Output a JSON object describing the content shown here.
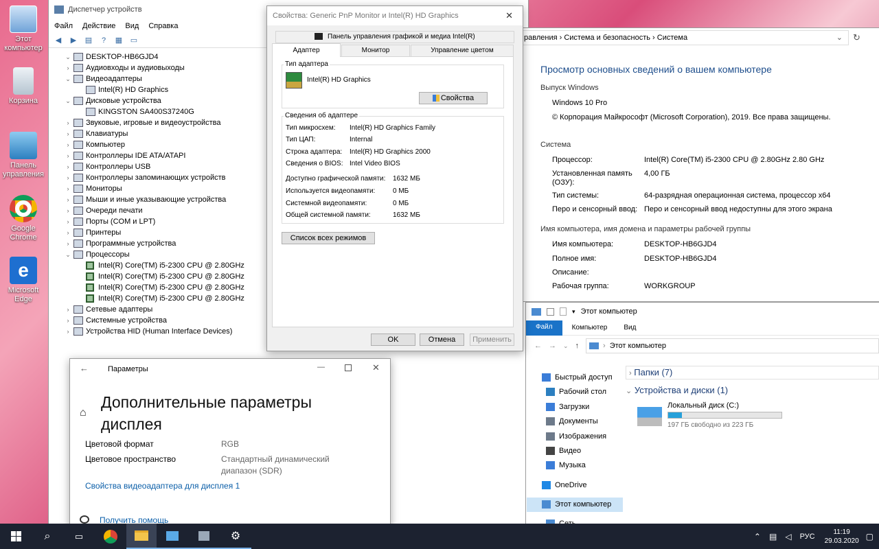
{
  "desktop": {
    "icons": [
      {
        "label": "Этот компьютер",
        "icon": "computer-icon"
      },
      {
        "label": "Корзина",
        "icon": "recycle-bin-icon"
      },
      {
        "label": "Панель управления",
        "icon": "control-panel-icon"
      },
      {
        "label": "Google Chrome",
        "icon": "chrome-icon"
      },
      {
        "label": "Microsoft Edge",
        "icon": "edge-icon"
      }
    ]
  },
  "devmgr": {
    "title": "Диспетчер устройств",
    "menu": [
      "Файл",
      "Действие",
      "Вид",
      "Справка"
    ],
    "tree": [
      {
        "label": "DESKTOP-HB6GJD4",
        "level": 0,
        "expanded": true
      },
      {
        "label": "Аудиовходы и аудиовыходы",
        "level": 1
      },
      {
        "label": "Видеоадаптеры",
        "level": 1,
        "expanded": true
      },
      {
        "label": "Intel(R) HD Graphics",
        "level": 2
      },
      {
        "label": "Дисковые устройства",
        "level": 1,
        "expanded": true
      },
      {
        "label": "KINGSTON SA400S37240G",
        "level": 2
      },
      {
        "label": "Звуковые, игровые и видеоустройства",
        "level": 1
      },
      {
        "label": "Клавиатуры",
        "level": 1
      },
      {
        "label": "Компьютер",
        "level": 1
      },
      {
        "label": "Контроллеры IDE ATA/ATAPI",
        "level": 1
      },
      {
        "label": "Контроллеры USB",
        "level": 1
      },
      {
        "label": "Контроллеры запоминающих устройств",
        "level": 1
      },
      {
        "label": "Мониторы",
        "level": 1
      },
      {
        "label": "Мыши и иные указывающие устройства",
        "level": 1
      },
      {
        "label": "Очереди печати",
        "level": 1
      },
      {
        "label": "Порты (COM и LPT)",
        "level": 1
      },
      {
        "label": "Принтеры",
        "level": 1
      },
      {
        "label": "Программные устройства",
        "level": 1
      },
      {
        "label": "Процессоры",
        "level": 1,
        "expanded": true
      },
      {
        "label": "Intel(R) Core(TM) i5-2300 CPU @ 2.80GHz",
        "level": 2,
        "cpu": true
      },
      {
        "label": "Intel(R) Core(TM) i5-2300 CPU @ 2.80GHz",
        "level": 2,
        "cpu": true
      },
      {
        "label": "Intel(R) Core(TM) i5-2300 CPU @ 2.80GHz",
        "level": 2,
        "cpu": true
      },
      {
        "label": "Intel(R) Core(TM) i5-2300 CPU @ 2.80GHz",
        "level": 2,
        "cpu": true
      },
      {
        "label": "Сетевые адаптеры",
        "level": 1
      },
      {
        "label": "Системные устройства",
        "level": 1
      },
      {
        "label": "Устройства HID (Human Interface Devices)",
        "level": 1
      }
    ]
  },
  "props": {
    "title": "Свойства: Generic PnP Monitor и Intel(R) HD Graphics",
    "top_tab": "Панель управления графикой и медиа Intel(R)",
    "tabs": [
      "Адаптер",
      "Монитор",
      "Управление цветом"
    ],
    "adapter_type_label": "Тип адаптера",
    "adapter_name": "Intel(R) HD Graphics",
    "properties_btn": "Свойства",
    "info_label": "Сведения об адаптере",
    "info": [
      {
        "k": "Тип микросхем:",
        "v": "Intel(R) HD Graphics Family"
      },
      {
        "k": "Тип ЦАП:",
        "v": "Internal"
      },
      {
        "k": "Строка адаптера:",
        "v": "Intel(R) HD Graphics 2000"
      },
      {
        "k": "Сведения о BIOS:",
        "v": "Intel Video BIOS"
      }
    ],
    "memory": [
      {
        "k": "Доступно графической памяти:",
        "v": "1632 МБ"
      },
      {
        "k": "Используется видеопамяти:",
        "v": "0 МБ"
      },
      {
        "k": "Системной видеопамяти:",
        "v": "0 МБ"
      },
      {
        "k": "Общей системной памяти:",
        "v": "1632 МБ"
      }
    ],
    "modes_btn": "Список всех режимов",
    "ok": "OK",
    "cancel": "Отмена",
    "apply": "Применить"
  },
  "system": {
    "breadcrumb": "равления  ›  Система и безопасность  ›  Система",
    "heading": "Просмотр основных сведений о вашем компьютере",
    "edition_section": "Выпуск Windows",
    "edition": "Windows 10 Pro",
    "copyright": "© Корпорация Майкрософт (Microsoft Corporation), 2019. Все права защищены.",
    "system_section": "Система",
    "rows": [
      {
        "k": "Процессор:",
        "v": "Intel(R) Core(TM) i5-2300 CPU @ 2.80GHz   2.80 GHz"
      },
      {
        "k": "Установленная память (ОЗУ):",
        "v": "4,00 ГБ"
      },
      {
        "k": "Тип системы:",
        "v": "64-разрядная операционная система, процессор x64"
      },
      {
        "k": "Перо и сенсорный ввод:",
        "v": "Перо и сенсорный ввод недоступны для этого экрана"
      }
    ],
    "name_section": "Имя компьютера, имя домена и параметры рабочей группы",
    "name_rows": [
      {
        "k": "Имя компьютера:",
        "v": "DESKTOP-HB6GJD4"
      },
      {
        "k": "Полное имя:",
        "v": "DESKTOP-HB6GJD4"
      },
      {
        "k": "Описание:",
        "v": ""
      },
      {
        "k": "Рабочая группа:",
        "v": "WORKGROUP"
      }
    ]
  },
  "explorer": {
    "title": "Этот компьютер",
    "ribbon": [
      "Файл",
      "Компьютер",
      "Вид"
    ],
    "address": "Этот компьютер",
    "nav": [
      {
        "label": "Быстрый доступ",
        "icon": "star-icon"
      },
      {
        "label": "Рабочий стол",
        "icon": "desktop-folder-icon"
      },
      {
        "label": "Загрузки",
        "icon": "downloads-icon"
      },
      {
        "label": "Документы",
        "icon": "documents-icon"
      },
      {
        "label": "Изображения",
        "icon": "pictures-icon"
      },
      {
        "label": "Видео",
        "icon": "video-icon"
      },
      {
        "label": "Музыка",
        "icon": "music-icon"
      },
      {
        "label": "OneDrive",
        "icon": "onedrive-icon"
      },
      {
        "label": "Этот компьютер",
        "icon": "computer-icon"
      },
      {
        "label": "Сеть",
        "icon": "network-icon"
      }
    ],
    "folders_group": "Папки (7)",
    "drives_group": "Устройства и диски (1)",
    "drive_name": "Локальный диск (C:)",
    "drive_free": "197 ГБ свободно из 223 ГБ",
    "drive_used_fraction": 0.12
  },
  "settings": {
    "title": "Параметры",
    "heading1": "Дополнительные параметры",
    "heading2": "дисплея",
    "rows": [
      {
        "k": "Цветовой формат",
        "v": "RGB"
      },
      {
        "k": "Цветовое пространство",
        "v": "Стандартный динамический"
      }
    ],
    "range_line2": "диапазон (SDR)",
    "link": "Свойства видеоадаптера для дисплея 1",
    "help": "Получить помощь"
  },
  "taskbar": {
    "lang": "РУС",
    "time": "11:19",
    "date": "29.03.2020"
  }
}
